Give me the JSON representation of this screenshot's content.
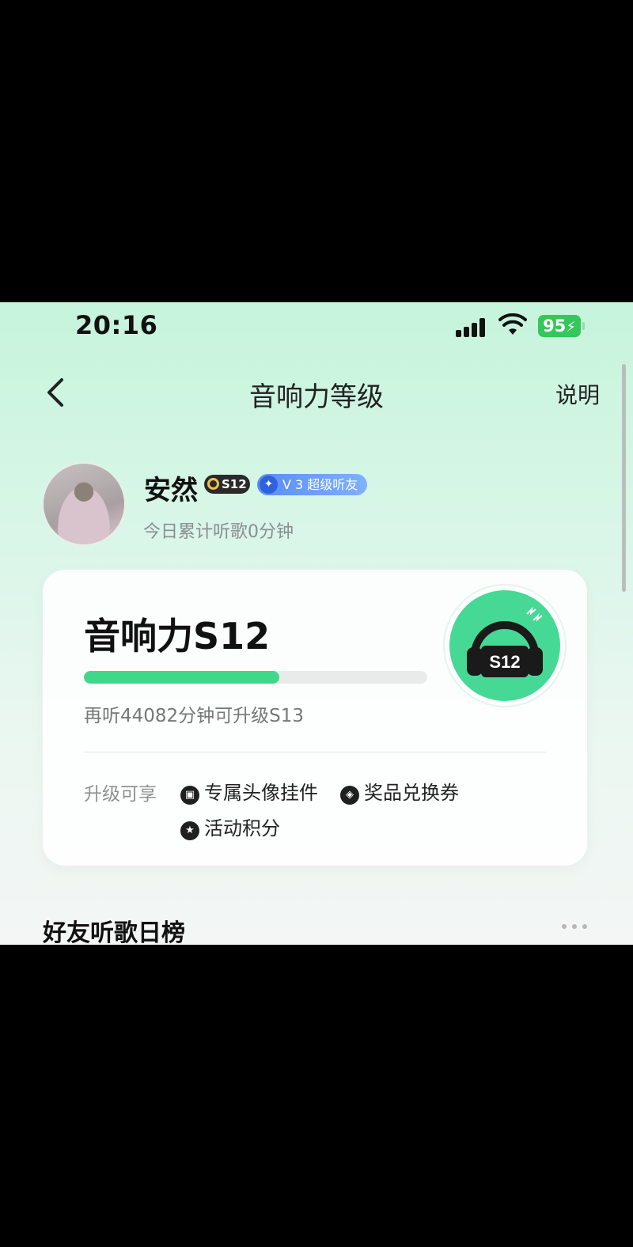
{
  "status_bar": {
    "time": "20:16",
    "battery": "95",
    "icons": [
      "signal-icon",
      "wifi-icon",
      "battery-charging-icon"
    ]
  },
  "nav": {
    "back_icon": "chevron-left-icon",
    "title": "音响力等级",
    "explain": "说明"
  },
  "profile": {
    "username": "安然",
    "level_badge": "S12",
    "vip_badge": "V 3 超级听友",
    "listen_today": "今日累计听歌0分钟"
  },
  "level_card": {
    "title": "音响力S12",
    "progress_percent": 57,
    "upgrade_hint": "再听44082分钟可升级S13",
    "perks_label": "升级可享",
    "perks": [
      {
        "icon": "avatar-frame-icon",
        "label": "专属头像挂件"
      },
      {
        "icon": "coupon-icon",
        "label": "奖品兑换券"
      },
      {
        "icon": "star-icon",
        "label": "活动积分"
      }
    ],
    "icon_badge": "S12"
  },
  "friends_section": {
    "title": "好友听歌日榜",
    "more_icon": "more-dots-icon"
  },
  "colors": {
    "accent_green": "#3fd88b",
    "vip_blue": "#5a8cf5",
    "battery_green": "#34c759"
  }
}
